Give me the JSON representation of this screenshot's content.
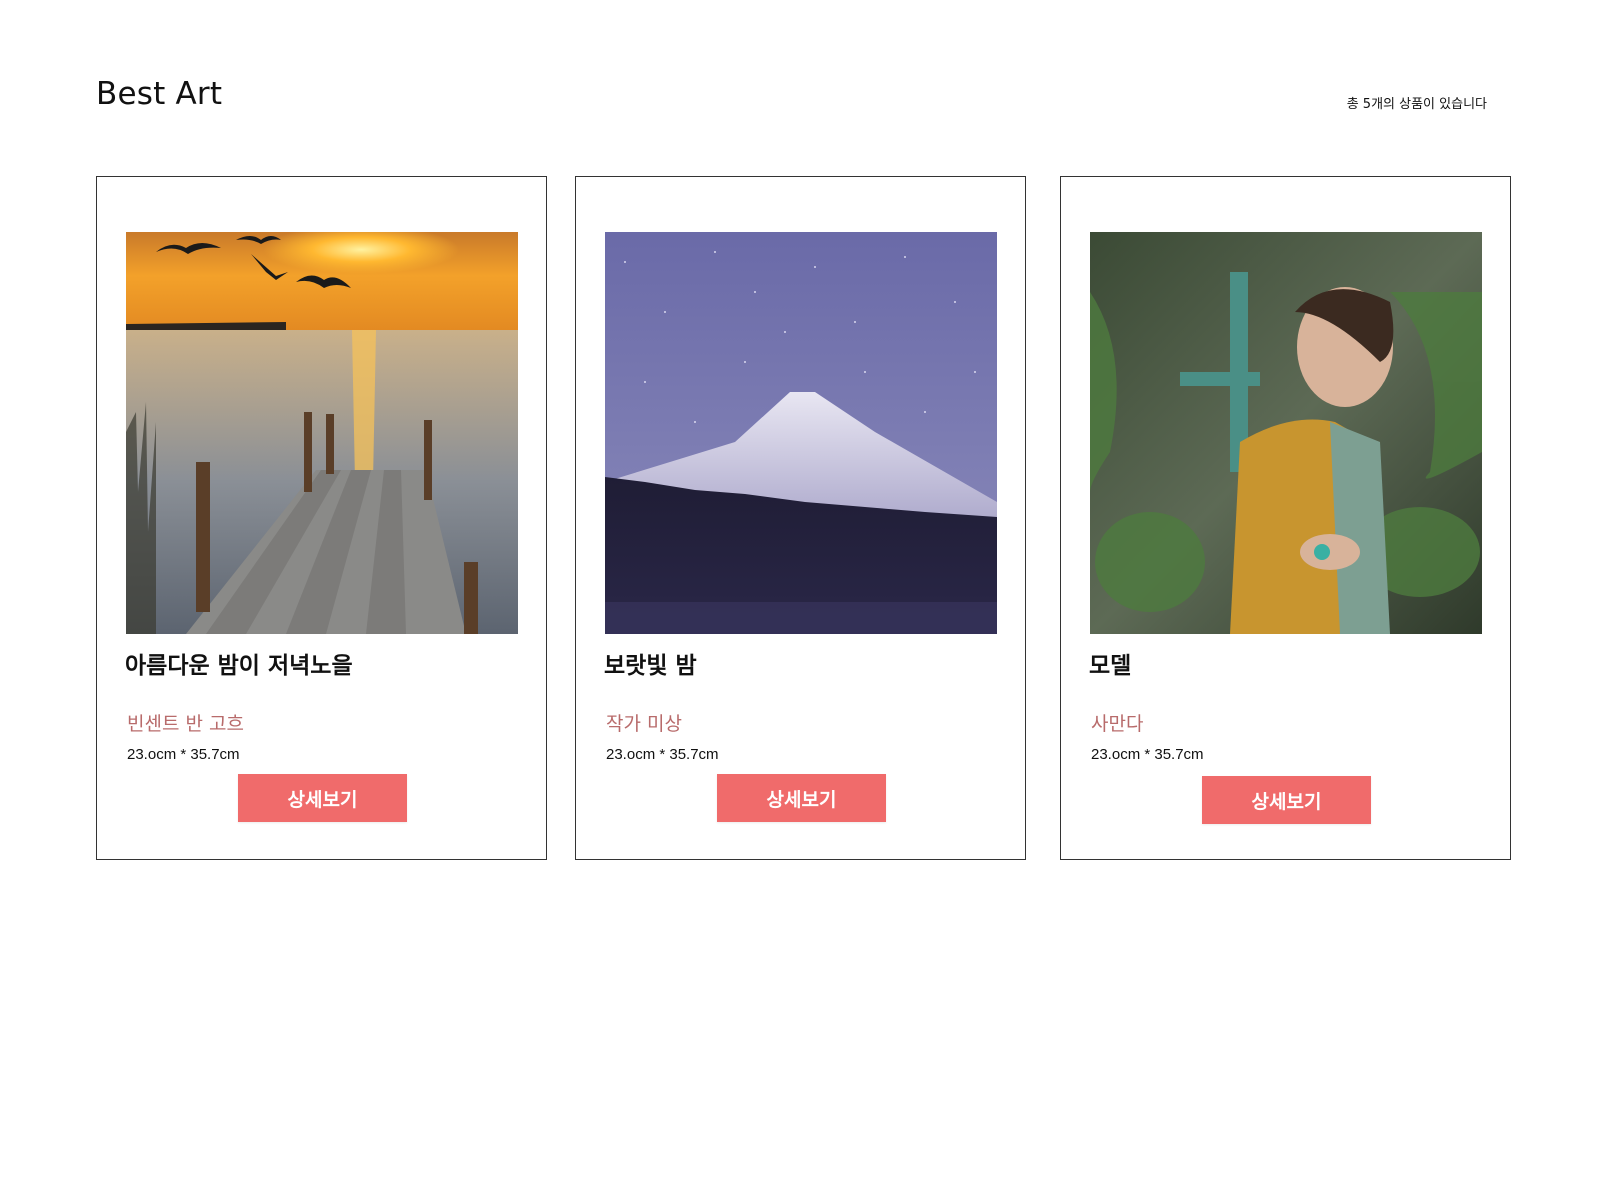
{
  "header": {
    "title": "Best Art",
    "count_text": "총 5개의 상품이 있습니다"
  },
  "colors": {
    "accent": "#f06b6b",
    "artist": "#b86b6b",
    "border": "#333333"
  },
  "cards": [
    {
      "title": "아름다운 밤이 저녁노을",
      "artist": "빈센트 반 고흐",
      "size": "23.ocm * 35.7cm",
      "button": "상세보기",
      "image": "sunset-dock-painting"
    },
    {
      "title": "보랏빛 밤",
      "artist": "작가 미상",
      "size": "23.ocm * 35.7cm",
      "button": "상세보기",
      "image": "mountain-night-sky"
    },
    {
      "title": "모델",
      "artist": "사만다",
      "size": "23.ocm * 35.7cm",
      "button": "상세보기",
      "image": "woman-in-greenhouse"
    }
  ]
}
